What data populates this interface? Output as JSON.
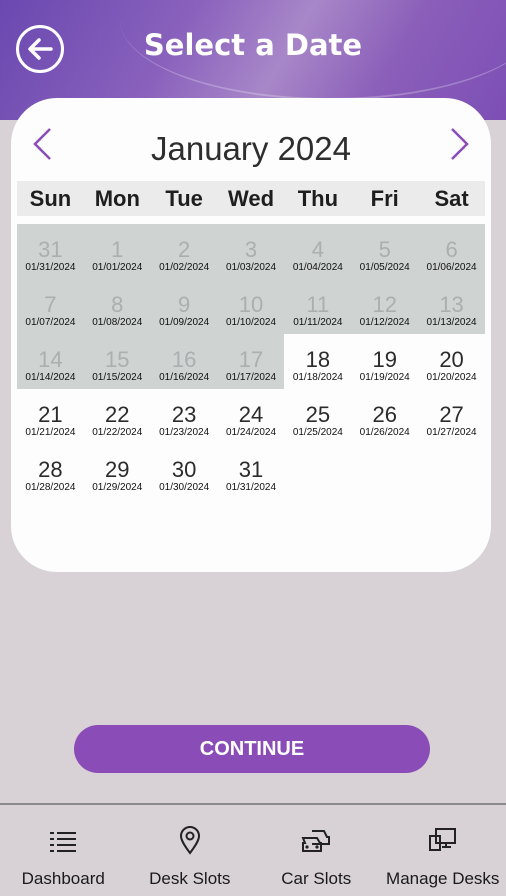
{
  "header": {
    "title": "Select a Date"
  },
  "calendar": {
    "month_title": "January 2024",
    "weekdays": [
      "Sun",
      "Mon",
      "Tue",
      "Wed",
      "Thu",
      "Fri",
      "Sat"
    ],
    "days": [
      {
        "num": "31",
        "date": "01/31/2024",
        "disabled": true
      },
      {
        "num": "1",
        "date": "01/01/2024",
        "disabled": true
      },
      {
        "num": "2",
        "date": "01/02/2024",
        "disabled": true
      },
      {
        "num": "3",
        "date": "01/03/2024",
        "disabled": true
      },
      {
        "num": "4",
        "date": "01/04/2024",
        "disabled": true
      },
      {
        "num": "5",
        "date": "01/05/2024",
        "disabled": true
      },
      {
        "num": "6",
        "date": "01/06/2024",
        "disabled": true
      },
      {
        "num": "7",
        "date": "01/07/2024",
        "disabled": true
      },
      {
        "num": "8",
        "date": "01/08/2024",
        "disabled": true
      },
      {
        "num": "9",
        "date": "01/09/2024",
        "disabled": true
      },
      {
        "num": "10",
        "date": "01/10/2024",
        "disabled": true
      },
      {
        "num": "11",
        "date": "01/11/2024",
        "disabled": true
      },
      {
        "num": "12",
        "date": "01/12/2024",
        "disabled": true
      },
      {
        "num": "13",
        "date": "01/13/2024",
        "disabled": true
      },
      {
        "num": "14",
        "date": "01/14/2024",
        "disabled": true
      },
      {
        "num": "15",
        "date": "01/15/2024",
        "disabled": true
      },
      {
        "num": "16",
        "date": "01/16/2024",
        "disabled": true
      },
      {
        "num": "17",
        "date": "01/17/2024",
        "disabled": true
      },
      {
        "num": "18",
        "date": "01/18/2024",
        "disabled": false
      },
      {
        "num": "19",
        "date": "01/19/2024",
        "disabled": false
      },
      {
        "num": "20",
        "date": "01/20/2024",
        "disabled": false
      },
      {
        "num": "21",
        "date": "01/21/2024",
        "disabled": false
      },
      {
        "num": "22",
        "date": "01/22/2024",
        "disabled": false
      },
      {
        "num": "23",
        "date": "01/23/2024",
        "disabled": false
      },
      {
        "num": "24",
        "date": "01/24/2024",
        "disabled": false
      },
      {
        "num": "25",
        "date": "01/25/2024",
        "disabled": false
      },
      {
        "num": "26",
        "date": "01/26/2024",
        "disabled": false
      },
      {
        "num": "27",
        "date": "01/27/2024",
        "disabled": false
      },
      {
        "num": "28",
        "date": "01/28/2024",
        "disabled": false
      },
      {
        "num": "29",
        "date": "01/29/2024",
        "disabled": false
      },
      {
        "num": "30",
        "date": "01/30/2024",
        "disabled": false
      },
      {
        "num": "31",
        "date": "01/31/2024",
        "disabled": false
      }
    ]
  },
  "continue_label": "CONTINUE",
  "bottom_nav": [
    {
      "label": "Dashboard",
      "icon": "list-icon"
    },
    {
      "label": "Desk Slots",
      "icon": "map-pin-icon"
    },
    {
      "label": "Car Slots",
      "icon": "cars-icon"
    },
    {
      "label": "Manage Desks",
      "icon": "desktop-icon"
    }
  ],
  "colors": {
    "accent": "#8a4cb6",
    "disabled_cell": "#cfd3d2",
    "page_bg": "#d8d1d6"
  }
}
